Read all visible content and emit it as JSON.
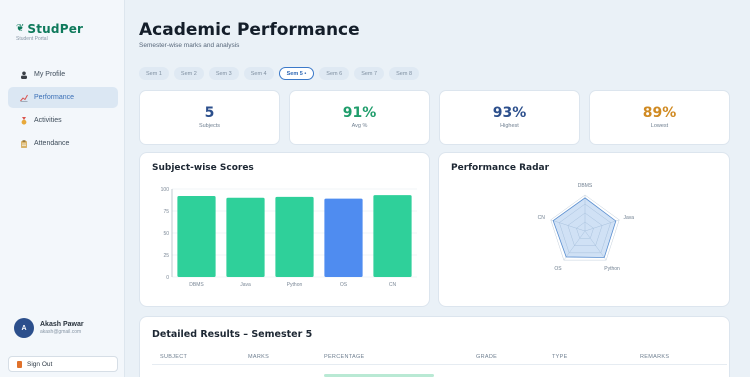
{
  "brand": {
    "name": "StudPer",
    "sub": "Student Portal",
    "icon": "graduation-cap-icon"
  },
  "sidebar": {
    "items": [
      {
        "label": "My Profile",
        "icon": "person-icon",
        "active": false
      },
      {
        "label": "Performance",
        "icon": "chart-line-icon",
        "active": true
      },
      {
        "label": "Activities",
        "icon": "medal-icon",
        "active": false
      },
      {
        "label": "Attendance",
        "icon": "clipboard-icon",
        "active": false
      }
    ]
  },
  "user": {
    "initial": "A",
    "name": "Akash Pawar",
    "email": "akash@gmail.com"
  },
  "signout_label": "Sign Out",
  "header": {
    "title": "Academic Performance",
    "subtitle": "Semester-wise marks and analysis"
  },
  "semesters": [
    "Sem 1",
    "Sem 2",
    "Sem 3",
    "Sem 4",
    "Sem 5 •",
    "Sem 6",
    "Sem 7",
    "Sem 8"
  ],
  "selected_semester_index": 4,
  "stats": [
    {
      "value": "5",
      "label": "Subjects",
      "color": "#2c4f8c"
    },
    {
      "value": "91%",
      "label": "Avg %",
      "color": "#1f9d6b"
    },
    {
      "value": "93%",
      "label": "Highest",
      "color": "#2c4f8c"
    },
    {
      "value": "89%",
      "label": "Lowest",
      "color": "#d08a22"
    }
  ],
  "scores_panel": {
    "title": "Subject-wise Scores"
  },
  "radar_panel": {
    "title": "Performance Radar"
  },
  "chart_data": [
    {
      "type": "bar",
      "title": "Subject-wise Scores",
      "categories": [
        "DBMS",
        "Java",
        "Python",
        "OS",
        "CN"
      ],
      "values": [
        92,
        90,
        91,
        89,
        93
      ],
      "colors": [
        "#2fd09a",
        "#2fd09a",
        "#2fd09a",
        "#4f8cf0",
        "#2fd09a"
      ],
      "ylim": [
        0,
        100
      ],
      "yticks": [
        "0",
        "25",
        "50",
        "75",
        "100"
      ],
      "grid": true
    },
    {
      "type": "radar",
      "title": "Performance Radar",
      "categories": [
        "DBMS",
        "Java",
        "Python",
        "OS",
        "CN"
      ],
      "values": [
        92,
        90,
        91,
        89,
        93
      ],
      "range": [
        0,
        100
      ]
    }
  ],
  "results": {
    "title": "Detailed Results – Semester 5",
    "columns": [
      "SUBJECT",
      "MARKS",
      "PERCENTAGE",
      "GRADE",
      "TYPE",
      "REMARKS"
    ]
  }
}
